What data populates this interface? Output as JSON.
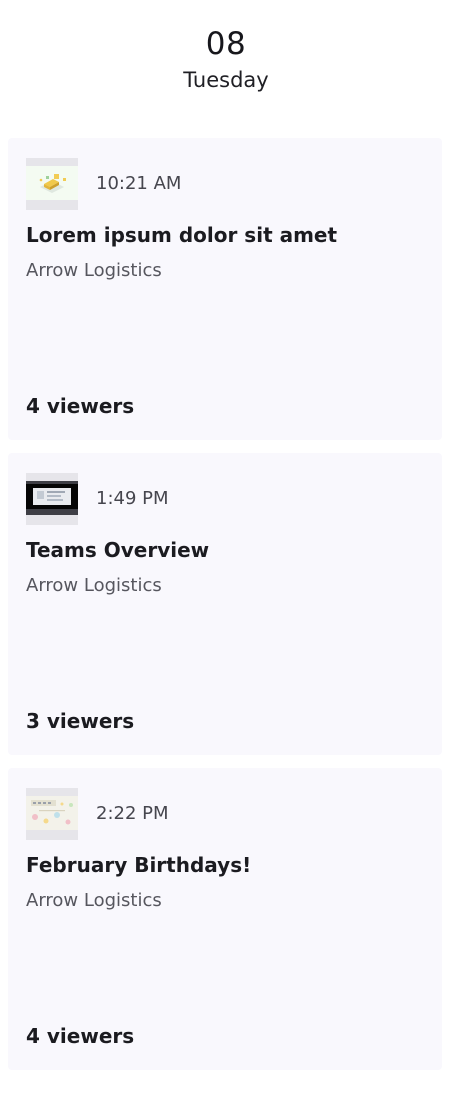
{
  "header": {
    "day_number": "08",
    "weekday": "Tuesday"
  },
  "cards": [
    {
      "time": "10:21 AM",
      "title": "Lorem ipsum dolor sit amet",
      "company": "Arrow Logistics",
      "viewers": "4 viewers",
      "thumbnail_icon": "isometric-illustration-icon"
    },
    {
      "time": "1:49 PM",
      "title": "Teams Overview",
      "company": "Arrow Logistics",
      "viewers": "3 viewers",
      "thumbnail_icon": "presentation-slide-icon"
    },
    {
      "time": "2:22 PM",
      "title": "February Birthdays!",
      "company": "Arrow Logistics",
      "viewers": "4 viewers",
      "thumbnail_icon": "birthday-banner-icon"
    }
  ],
  "colors": {
    "card_background": "#f9f8fd",
    "thumbnail_frame": "#e6e5ea",
    "primary_text": "#1b1b20",
    "secondary_text": "#56565e"
  }
}
